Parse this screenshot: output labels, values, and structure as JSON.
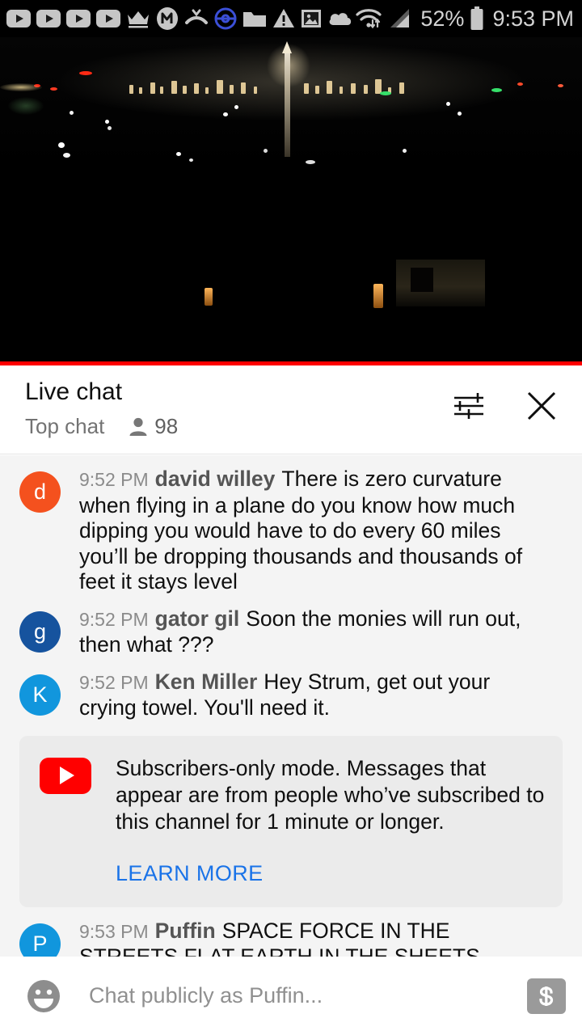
{
  "statusbar": {
    "icons_left": [
      "youtube-play-icon",
      "youtube-play-icon",
      "youtube-play-icon",
      "youtube-play-icon",
      "crown-icon",
      "messenger-m-icon",
      "missed-call-icon",
      "pokeball-icon",
      "folder-icon",
      "warning-triangle-icon",
      "photo-icon",
      "cloud-icon"
    ],
    "icons_right": [
      "wifi-icon",
      "cell-signal-icon",
      "battery-icon"
    ],
    "battery_percent": "52%",
    "time": "9:53 PM"
  },
  "video": {
    "description": "night cityscape with distant lights and a lit monument",
    "progress_color": "#ff0000",
    "progress_percent": 100
  },
  "chat_header": {
    "title": "Live chat",
    "mode": "Top chat",
    "viewer_count": "98",
    "viewer_icon": "person-icon",
    "settings_icon": "chat-settings-sliders-icon",
    "close_icon": "close-x-icon"
  },
  "messages": [
    {
      "id": "msg-david-willey",
      "timestamp": "9:52 PM",
      "author": "david willey",
      "text": "There is zero curvature when flying in a plane do you know how much dipping you would have to do every 60 miles you’ll be dropping thousands and thousands of feet it stays level",
      "avatar_letter": "d",
      "avatar_color": "#f4511e"
    },
    {
      "id": "msg-gator-gil",
      "timestamp": "9:52 PM",
      "author": "gator gil",
      "text": "Soon the monies will run out, then what ???",
      "avatar_letter": "g",
      "avatar_color": "#16539e"
    },
    {
      "id": "msg-ken-miller",
      "timestamp": "9:52 PM",
      "author": "Ken Miller",
      "text": "Hey Strum, get out your crying towel. You'll need it.",
      "avatar_letter": "K",
      "avatar_color": "#1196dd"
    }
  ],
  "notice": {
    "icon": "youtube-logo-icon",
    "text": "Subscribers-only mode. Messages that appear are from people who’ve subscribed to this channel for 1 minute or longer.",
    "link_label": "LEARN MORE",
    "link_color": "#1a73e8"
  },
  "messages_after_notice": [
    {
      "id": "msg-puffin",
      "timestamp": "9:53 PM",
      "author": "Puffin",
      "text": "SPACE FORCE IN THE STREETS FLAT EARTH IN THE SHEETS",
      "avatar_letter": "P",
      "avatar_color": "#1196dd"
    }
  ],
  "input_bar": {
    "emoji_icon": "emoji-smiley-icon",
    "placeholder": "Chat publicly as Puffin...",
    "value": "",
    "superchat_icon": "dollar-superchat-icon"
  }
}
